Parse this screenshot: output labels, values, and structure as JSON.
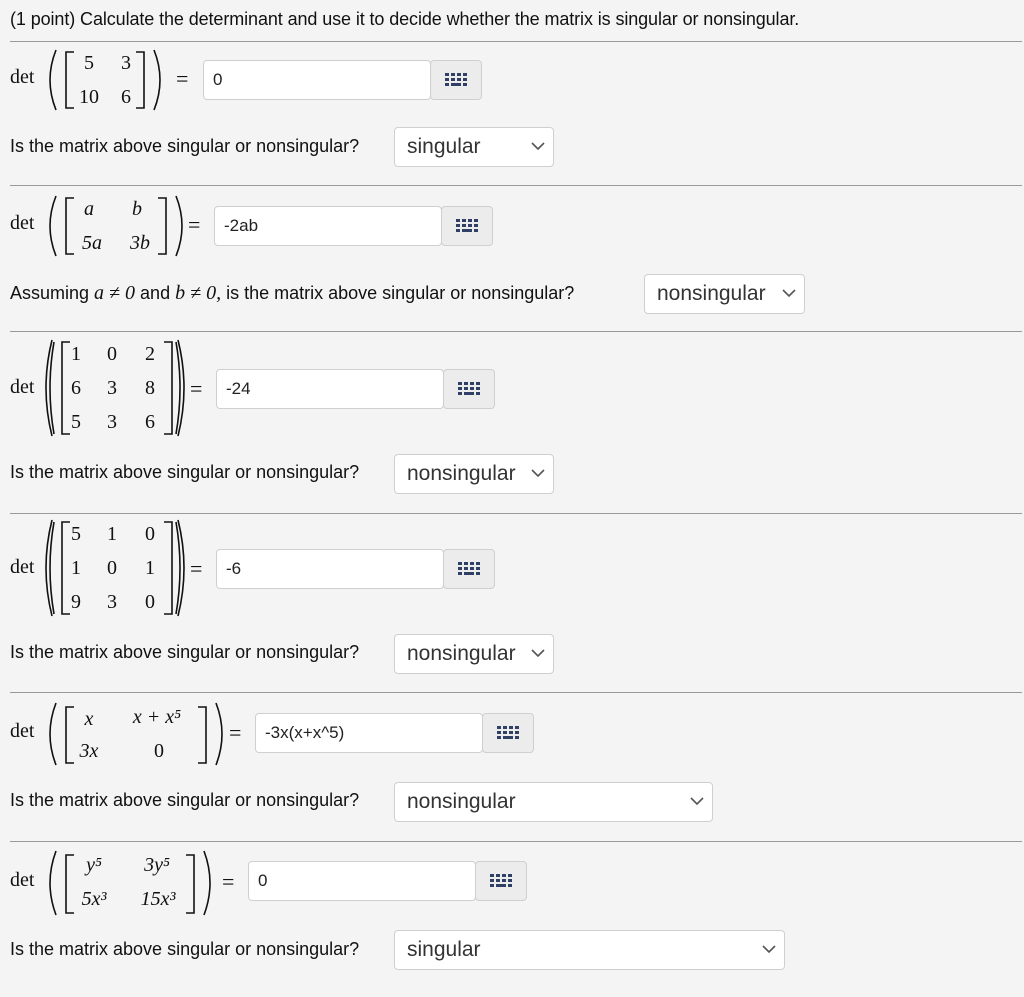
{
  "header": {
    "points": "(1 point)",
    "instruction": "Calculate the determinant and use it to decide whether the matrix is singular or nonsingular."
  },
  "det_label": "det",
  "equals_sign": "=",
  "problems": [
    {
      "matrix": [
        [
          "5",
          "3"
        ],
        [
          "10",
          "6"
        ]
      ],
      "answer": "0",
      "question": "Is the matrix above singular or nonsingular?",
      "selected": "singular"
    },
    {
      "matrix": [
        [
          "a",
          "b"
        ],
        [
          "5a",
          "3b"
        ]
      ],
      "answer": "-2ab",
      "question_prefix": "Assuming",
      "cond_a": "a ≠ 0",
      "question_and": "and",
      "cond_b": "b ≠ 0,",
      "question_suffix": "is the matrix above singular or nonsingular?",
      "selected": "nonsingular"
    },
    {
      "matrix": [
        [
          "1",
          "0",
          "2"
        ],
        [
          "6",
          "3",
          "8"
        ],
        [
          "5",
          "3",
          "6"
        ]
      ],
      "answer": "-24",
      "question": "Is the matrix above singular or nonsingular?",
      "selected": "nonsingular"
    },
    {
      "matrix": [
        [
          "5",
          "1",
          "0"
        ],
        [
          "1",
          "0",
          "1"
        ],
        [
          "9",
          "3",
          "0"
        ]
      ],
      "answer": "-6",
      "question": "Is the matrix above singular or nonsingular?",
      "selected": "nonsingular"
    },
    {
      "matrix": [
        [
          "x",
          "x + x⁵"
        ],
        [
          "3x",
          "0"
        ]
      ],
      "answer": "-3x(x+x^5)",
      "question": "Is the matrix above singular or nonsingular?",
      "selected": "nonsingular"
    },
    {
      "matrix": [
        [
          "y⁵",
          "3y⁵"
        ],
        [
          "5x³",
          "15x³"
        ]
      ],
      "answer": "0",
      "question": "Is the matrix above singular or nonsingular?",
      "selected": "singular"
    }
  ],
  "icons": {
    "keyboard": "equation-editor-grid-icon",
    "dropdown": "chevron-down-icon"
  },
  "colors": {
    "background": "#f4f4f4",
    "input_border": "#cfcfcf",
    "rule": "#9a9a9a"
  }
}
